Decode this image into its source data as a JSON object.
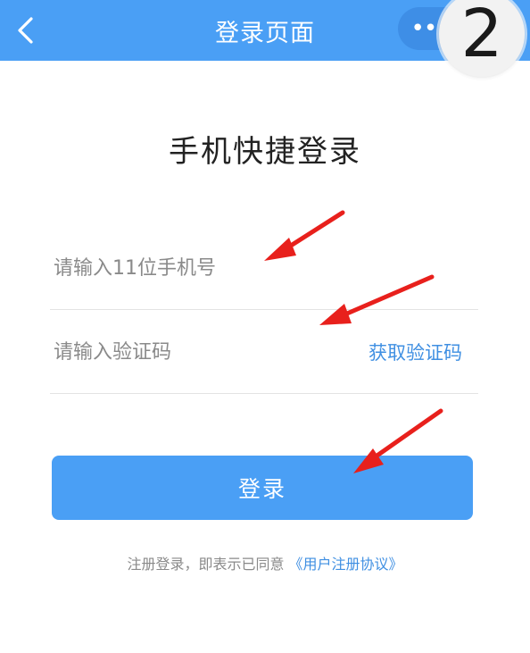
{
  "navbar": {
    "title": "登录页面",
    "back_icon": "chevron-left-icon",
    "more_label": "•••"
  },
  "step_badge": "2",
  "heading": "手机快捷登录",
  "phone_field": {
    "placeholder": "请输入11位手机号",
    "value": ""
  },
  "code_field": {
    "placeholder": "请输入验证码",
    "value": "",
    "get_code_label": "获取验证码"
  },
  "login_button": {
    "label": "登录"
  },
  "agreement": {
    "prefix": "注册登录，即表示已同意",
    "link_label": "《用户注册协议》"
  },
  "colors": {
    "primary": "#4a9ff5",
    "link": "#3f8fe2",
    "annotation": "#e8201c"
  }
}
